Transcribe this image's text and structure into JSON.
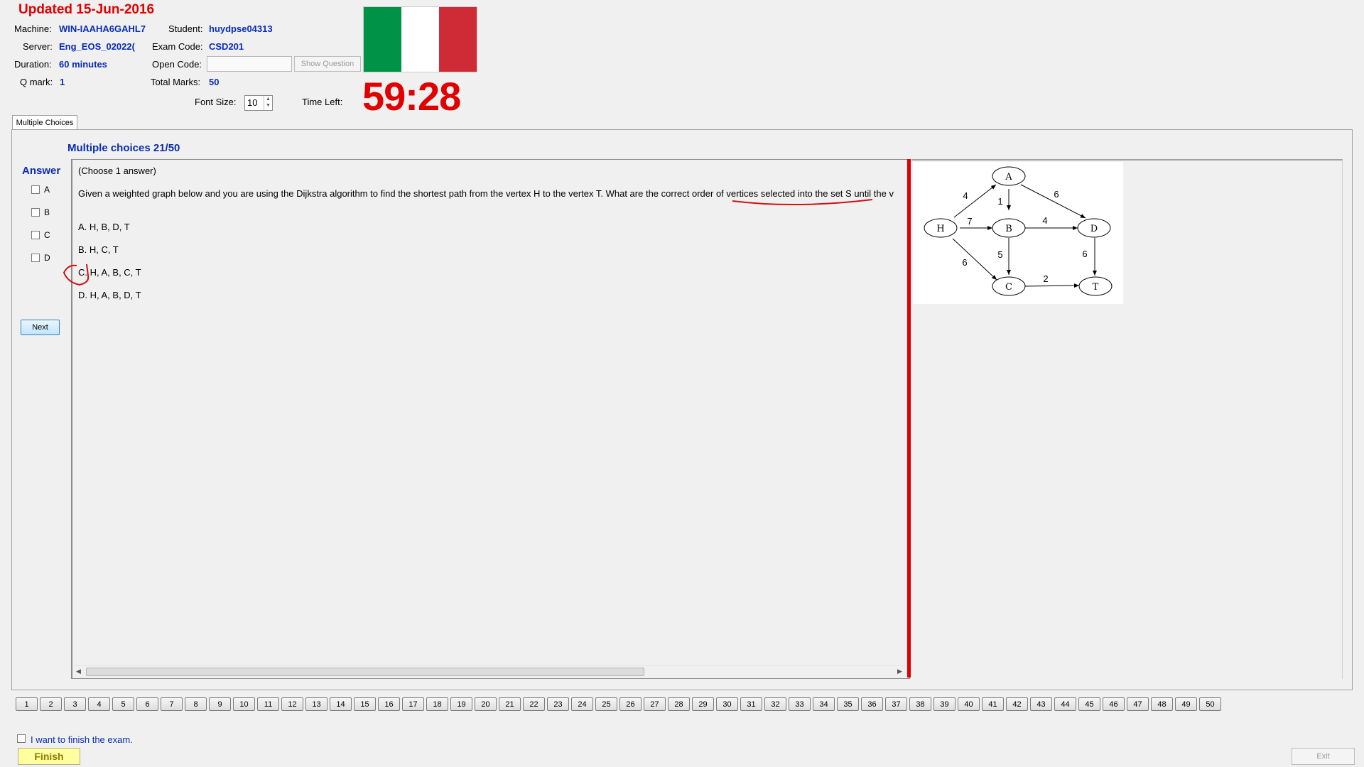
{
  "header": {
    "updated": "Updated 15-Jun-2016",
    "machine_label": "Machine:",
    "machine_value": "WIN-IAAHA6GAHL7",
    "student_label": "Student:",
    "student_value": "huydpse04313",
    "server_label": "Server:",
    "server_value": "Eng_EOS_02022(",
    "exam_code_label": "Exam Code:",
    "exam_code_value": "CSD201",
    "duration_label": "Duration:",
    "duration_value": "60 minutes",
    "open_code_label": "Open Code:",
    "open_code_value": "",
    "show_question_label": "Show Question",
    "qmark_label": "Q mark:",
    "qmark_value": "1",
    "total_marks_label": "Total Marks:",
    "total_marks_value": "50",
    "font_size_label": "Font Size:",
    "font_size_value": "10",
    "time_left_label": "Time Left:",
    "time_left_value": "59:28",
    "flag_colors": [
      "#009246",
      "#ffffff",
      "#ce2b37"
    ]
  },
  "tab": {
    "label": "Multiple Choices"
  },
  "question": {
    "heading": "Multiple choices 21/50",
    "instruction": "(Choose 1 answer)",
    "text": "Given a weighted graph below and you are using the Dijkstra algorithm to find the shortest path from the vertex  H  to the vertex  T. What are the correct order of vertices selected into the set  S until the v",
    "options": [
      "A.  H, B, D, T",
      "B.  H, C, T",
      "C.  H, A, B, C, T",
      "D.  H, A, B, D, T"
    ]
  },
  "answer": {
    "label": "Answer",
    "choices": [
      "A",
      "B",
      "C",
      "D"
    ],
    "next_label": "Next"
  },
  "graph": {
    "nodes": [
      "A",
      "H",
      "B",
      "D",
      "C",
      "T"
    ],
    "edge_weights": [
      "4",
      "1",
      "6",
      "7",
      "4",
      "6",
      "5",
      "6",
      "2"
    ]
  },
  "question_numbers": [
    "1",
    "2",
    "3",
    "4",
    "5",
    "6",
    "7",
    "8",
    "9",
    "10",
    "11",
    "12",
    "13",
    "14",
    "15",
    "16",
    "17",
    "18",
    "19",
    "20",
    "21",
    "22",
    "23",
    "24",
    "25",
    "26",
    "27",
    "28",
    "29",
    "30",
    "31",
    "32",
    "33",
    "34",
    "35",
    "36",
    "37",
    "38",
    "39",
    "40",
    "41",
    "42",
    "43",
    "44",
    "45",
    "46",
    "47",
    "48",
    "49",
    "50"
  ],
  "footer": {
    "finish_checkbox_label": "I want to finish the exam.",
    "finish_label": "Finish",
    "exit_label": "Exit"
  }
}
